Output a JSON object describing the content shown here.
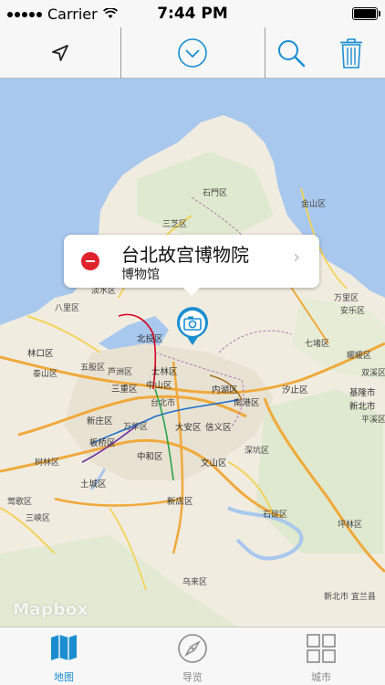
{
  "status_bar": {
    "carrier": "Carrier",
    "time": "7:44 PM"
  },
  "toolbar": {
    "location_icon": "location-arrow-icon",
    "dropdown_icon": "chevron-down-circle-icon",
    "search_icon": "search-icon",
    "trash_icon": "trash-icon",
    "accent_color": "#1a8ed0"
  },
  "callout": {
    "title": "台北故宫博物院",
    "subtitle": "博物馆",
    "remove_icon": "remove-circle-icon",
    "disclosure_icon": "chevron-right-icon"
  },
  "map": {
    "attribution": "Mapbox",
    "pin_icon": "camera-icon",
    "labels": [
      {
        "text": "石門区"
      },
      {
        "text": "三芝区"
      },
      {
        "text": "金山区"
      },
      {
        "text": "淡水区"
      },
      {
        "text": "万里区"
      },
      {
        "text": "八里区"
      },
      {
        "text": "北投区"
      },
      {
        "text": "林口区"
      },
      {
        "text": "五股区"
      },
      {
        "text": "泰山区"
      },
      {
        "text": "士林区"
      },
      {
        "text": "芦洲区"
      },
      {
        "text": "三重区"
      },
      {
        "text": "中山区"
      },
      {
        "text": "内湖区"
      },
      {
        "text": "南港区"
      },
      {
        "text": "汐止区"
      },
      {
        "text": "新庄区"
      },
      {
        "text": "万华区"
      },
      {
        "text": "大安区"
      },
      {
        "text": "信义区"
      },
      {
        "text": "板桥区"
      },
      {
        "text": "中和区"
      },
      {
        "text": "文山区"
      },
      {
        "text": "深坑区"
      },
      {
        "text": "树林区"
      },
      {
        "text": "土城区"
      },
      {
        "text": "新店区"
      },
      {
        "text": "莺歌区"
      },
      {
        "text": "三峡区"
      },
      {
        "text": "石碇区"
      },
      {
        "text": "坪林区"
      },
      {
        "text": "乌来区"
      },
      {
        "text": "安乐区"
      },
      {
        "text": "七堵区"
      },
      {
        "text": "暖暖区"
      },
      {
        "text": "基隆市"
      },
      {
        "text": "新北市"
      },
      {
        "text": "平溪区"
      },
      {
        "text": "双溪区"
      },
      {
        "text": "台北市"
      },
      {
        "text": "新北市 宜兰县"
      }
    ]
  },
  "tabs": [
    {
      "label": "地图",
      "icon": "map-icon",
      "active": true
    },
    {
      "label": "导览",
      "icon": "compass-icon",
      "active": false
    },
    {
      "label": "城市",
      "icon": "grid-icon",
      "active": false
    }
  ]
}
